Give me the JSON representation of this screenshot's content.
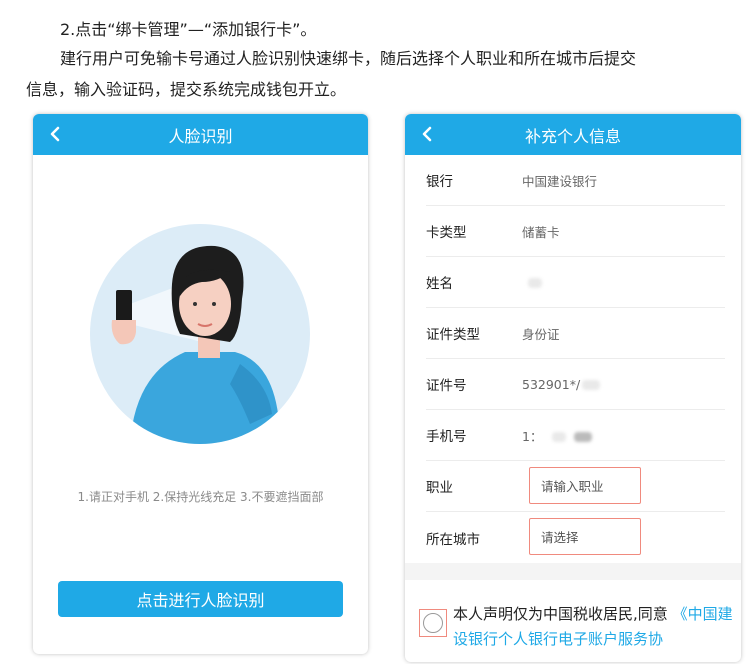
{
  "doc": {
    "step": "2.点击“绑卡管理”—“添加银行卡”。",
    "para_line1": "建行用户可免输卡号通过人脸识别快速绑卡，随后选择个人职业和所在城市后提交",
    "para_line2": "信息，输入验证码，提交系统完成钱包开立。"
  },
  "left_screen": {
    "title": "人脸识别",
    "hint": "1.请正对手机 2.保持光线充足 3.不要遮挡面部",
    "button": "点击进行人脸识别"
  },
  "right_screen": {
    "title": "补充个人信息",
    "rows": [
      {
        "label": "银行",
        "value": "中国建设银行"
      },
      {
        "label": "卡类型",
        "value": "储蓄卡"
      },
      {
        "label": "姓名",
        "value": ""
      },
      {
        "label": "证件类型",
        "value": "身份证"
      },
      {
        "label": "证件号",
        "value": "532901*/"
      },
      {
        "label": "手机号",
        "value": "1："
      }
    ],
    "occupation_label": "职业",
    "occupation_placeholder": "请输入职业",
    "city_label": "所在城市",
    "city_placeholder": "请选择",
    "consent_text": "本人声明仅为中国税收居民,同意",
    "consent_link": "《中国建设银行个人银行电子账户服务协"
  },
  "colors": {
    "brand_blue": "#1fa9e6",
    "highlight_red": "#f08a7e"
  }
}
